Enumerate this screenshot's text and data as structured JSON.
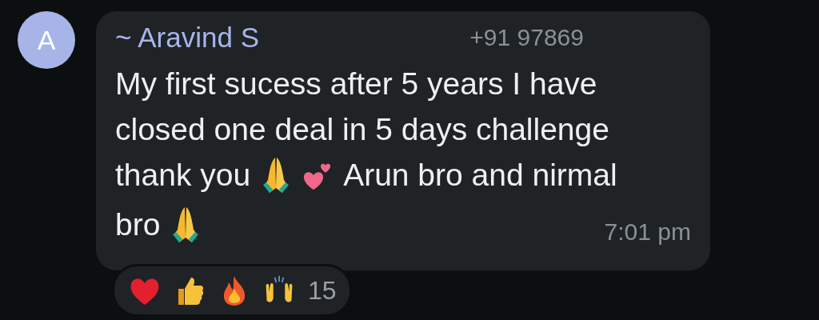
{
  "message": {
    "avatar": "A",
    "sender": "~ Aravind S",
    "phone": "+91 97869",
    "lines": [
      {
        "parts": [
          {
            "kind": "text",
            "text": "My first sucess after 5 years I have"
          }
        ]
      },
      {
        "parts": [
          {
            "kind": "text",
            "text": "closed one deal in 5 days challenge"
          }
        ]
      },
      {
        "parts": [
          {
            "kind": "text",
            "text": "thank you"
          },
          {
            "kind": "pray"
          },
          {
            "kind": "hearts"
          },
          {
            "kind": "text",
            "text": "Arun bro and nirmal"
          }
        ]
      },
      {
        "parts": [
          {
            "kind": "text",
            "text": "bro"
          },
          {
            "kind": "pray"
          }
        ]
      }
    ],
    "time": "7:01 pm",
    "reactions": [
      {
        "kind": "heart"
      },
      {
        "kind": "thumbs"
      },
      {
        "kind": "fire"
      },
      {
        "kind": "raised"
      }
    ],
    "reaction_count": "15"
  }
}
